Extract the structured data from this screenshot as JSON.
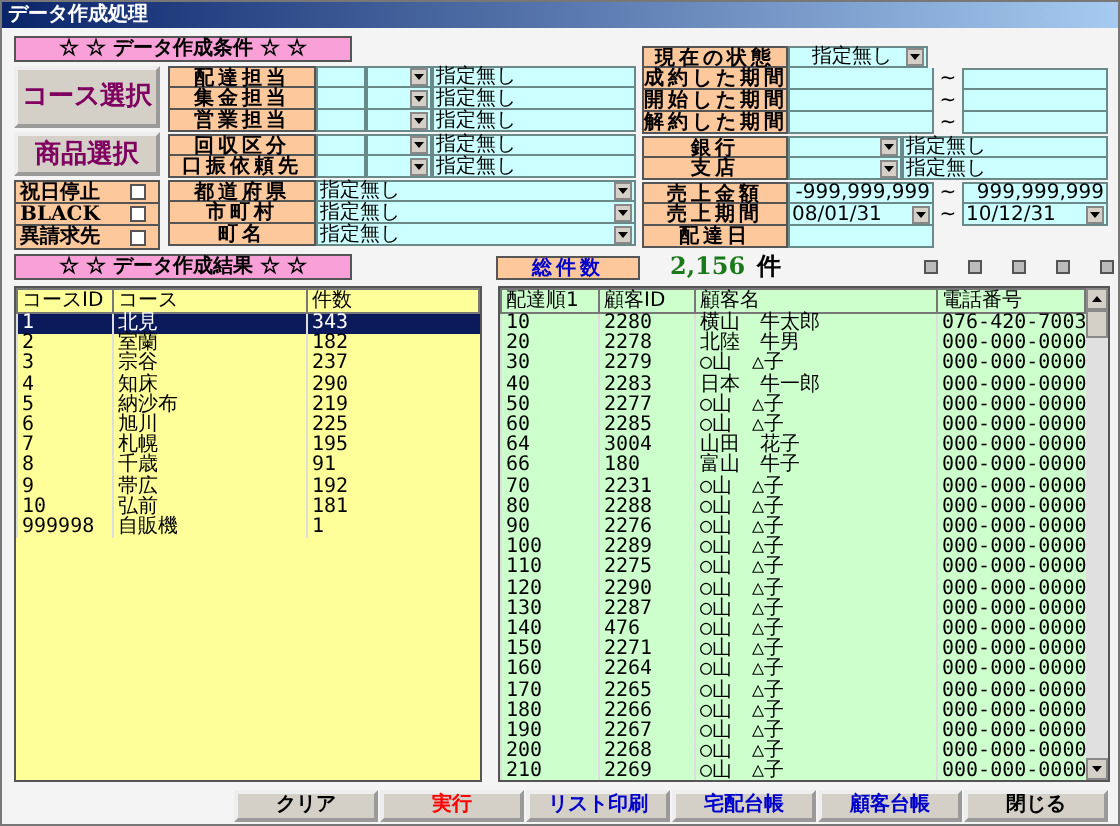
{
  "window": {
    "title": "データ作成処理"
  },
  "conditions": {
    "heading": "☆ ☆ データ作成条件 ☆ ☆",
    "select_buttons": [
      "コース選択",
      "商品選択"
    ],
    "flags": [
      {
        "label": "祝日停止",
        "checked": false
      },
      {
        "label": "BLACK",
        "checked": false
      },
      {
        "label": "異請求先",
        "checked": false
      }
    ],
    "staff_filters": [
      {
        "label": "配達担当",
        "value": "指定無し"
      },
      {
        "label": "集金担当",
        "value": "指定無し"
      },
      {
        "label": "営業担当",
        "value": "指定無し"
      }
    ],
    "category_filters": [
      {
        "label": "回収区分",
        "value": "指定無し"
      },
      {
        "label": "口振依頼先",
        "value": "指定無し"
      }
    ],
    "area_filters": [
      {
        "label": "都道府県",
        "value": "指定無し"
      },
      {
        "label": "市町村",
        "value": "指定無し"
      },
      {
        "label": "町名",
        "value": "指定無し"
      }
    ],
    "status": {
      "label": "現在の状態",
      "value": "指定無し"
    },
    "periods": [
      {
        "label": "成約した期間",
        "separator": "~"
      },
      {
        "label": "開始した期間",
        "separator": "~"
      },
      {
        "label": "解約した期間",
        "separator": "~"
      }
    ],
    "bank_filters": [
      {
        "label": "銀行",
        "value": "指定無し"
      },
      {
        "label": "支店",
        "value": "指定無し"
      }
    ],
    "ranges": [
      {
        "kind": "text",
        "label": "売上金額",
        "from": "-999,999,999",
        "separator": "~",
        "to": "999,999,999"
      },
      {
        "kind": "combo",
        "label": "売上期間",
        "from": "08/01/31",
        "separator": "~",
        "to": "10/12/31"
      },
      {
        "kind": "single",
        "label": "配達日"
      }
    ]
  },
  "results": {
    "heading": "☆ ☆ データ作成結果 ☆ ☆",
    "total_label": "総件数",
    "total": "2,156",
    "unit": "件",
    "courses": {
      "columns": [
        "コースID",
        "コース",
        "件数"
      ],
      "rows": [
        {
          "cells": [
            "1",
            "北見",
            "343"
          ],
          "selected": true
        },
        {
          "cells": [
            "2",
            "室蘭",
            "182"
          ],
          "selected": false
        },
        {
          "cells": [
            "3",
            "宗谷",
            "237"
          ],
          "selected": false
        },
        {
          "cells": [
            "4",
            "知床",
            "290"
          ],
          "selected": false
        },
        {
          "cells": [
            "5",
            "納沙布",
            "219"
          ],
          "selected": false
        },
        {
          "cells": [
            "6",
            "旭川",
            "225"
          ],
          "selected": false
        },
        {
          "cells": [
            "7",
            "札幌",
            "195"
          ],
          "selected": false
        },
        {
          "cells": [
            "8",
            "千歳",
            "91"
          ],
          "selected": false
        },
        {
          "cells": [
            "9",
            "帯広",
            "192"
          ],
          "selected": false
        },
        {
          "cells": [
            "10",
            "弘前",
            "181"
          ],
          "selected": false
        },
        {
          "cells": [
            "999998",
            "自販機",
            "1"
          ],
          "selected": false
        }
      ]
    },
    "customers": {
      "columns": [
        "配達順1",
        "顧客ID",
        "顧客名",
        "電話番号"
      ],
      "rows": [
        [
          "10",
          "2280",
          "横山　牛太郎",
          "076-420-7003"
        ],
        [
          "20",
          "2278",
          "北陸　牛男",
          "000-000-0000"
        ],
        [
          "30",
          "2279",
          "○山　△子",
          "000-000-0000"
        ],
        [
          "40",
          "2283",
          "日本　牛一郎",
          "000-000-0000"
        ],
        [
          "50",
          "2277",
          "○山　△子",
          "000-000-0000"
        ],
        [
          "60",
          "2285",
          "○山　△子",
          "000-000-0000"
        ],
        [
          "64",
          "3004",
          "山田　花子",
          "000-000-0000"
        ],
        [
          "66",
          "180",
          "富山　牛子",
          "000-000-0000"
        ],
        [
          "70",
          "2231",
          "○山　△子",
          "000-000-0000"
        ],
        [
          "80",
          "2288",
          "○山　△子",
          "000-000-0000"
        ],
        [
          "90",
          "2276",
          "○山　△子",
          "000-000-0000"
        ],
        [
          "100",
          "2289",
          "○山　△子",
          "000-000-0000"
        ],
        [
          "110",
          "2275",
          "○山　△子",
          "000-000-0000"
        ],
        [
          "120",
          "2290",
          "○山　△子",
          "000-000-0000"
        ],
        [
          "130",
          "2287",
          "○山　△子",
          "000-000-0000"
        ],
        [
          "140",
          "476",
          "○山　△子",
          "000-000-0000"
        ],
        [
          "150",
          "2271",
          "○山　△子",
          "000-000-0000"
        ],
        [
          "160",
          "2264",
          "○山　△子",
          "000-000-0000"
        ],
        [
          "170",
          "2265",
          "○山　△子",
          "000-000-0000"
        ],
        [
          "180",
          "2266",
          "○山　△子",
          "000-000-0000"
        ],
        [
          "190",
          "2267",
          "○山　△子",
          "000-000-0000"
        ],
        [
          "200",
          "2268",
          "○山　△子",
          "000-000-0000"
        ],
        [
          "210",
          "2269",
          "○山　△子",
          "000-000-0000"
        ]
      ]
    }
  },
  "buttons": [
    {
      "label": "クリア",
      "color": "#000000"
    },
    {
      "label": "実行",
      "color": "#ff0000"
    },
    {
      "label": "リスト印刷",
      "color": "#0000cc"
    },
    {
      "label": "宅配台帳",
      "color": "#0000cc"
    },
    {
      "label": "顧客台帳",
      "color": "#0000cc"
    },
    {
      "label": "閉じる",
      "color": "#000000"
    }
  ]
}
